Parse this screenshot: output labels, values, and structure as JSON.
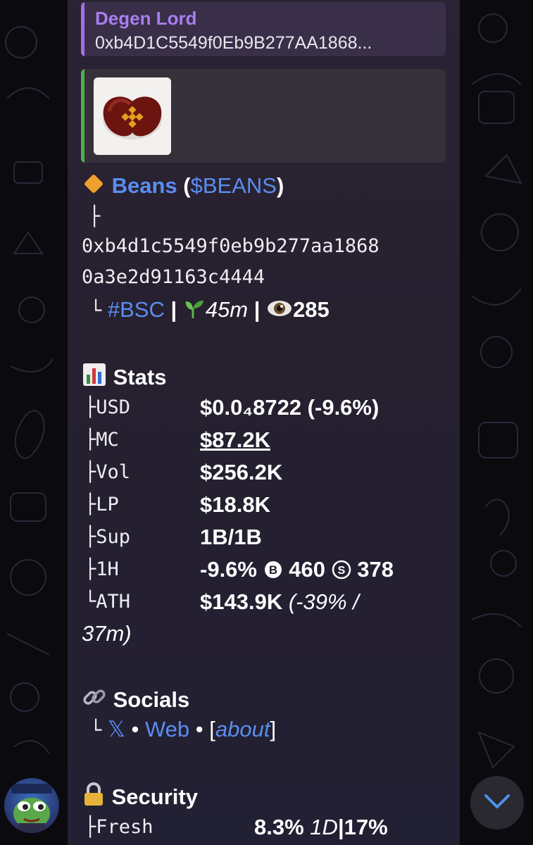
{
  "reply": {
    "sender": "Degen Lord",
    "preview": "0xb4D1C5549f0Eb9B277AA1868..."
  },
  "token": {
    "name": "Beans",
    "ticker": "$BEANS",
    "tree_mid": "├",
    "address_line1": "0xb4d1c5549f0eb9b277aa1868",
    "address_line2": "0a3e2d91163c4444",
    "tree_end": "└",
    "chain_tag": "#BSC",
    "age": "45m",
    "views": "285"
  },
  "stats": {
    "heading": "Stats",
    "rows": [
      {
        "label": "├USD",
        "value": "$0.0₄8722 (-9.6%)"
      },
      {
        "label": "├MC",
        "value": "$87.2K"
      },
      {
        "label": "├Vol",
        "value": "$256.2K"
      },
      {
        "label": "├LP",
        "value": "$18.8K"
      },
      {
        "label": "├Sup",
        "value": "1B/1B"
      },
      {
        "label": "├1H",
        "value": "-9.6%",
        "buys": "460",
        "sells": "378"
      },
      {
        "label": "└ATH",
        "value": "$143.9K",
        "value_extra": "(-39% /",
        "value_cont": "37m)"
      }
    ]
  },
  "socials": {
    "heading": "Socials",
    "tree": "└",
    "x_link": "𝕏",
    "sep": "•",
    "web_link": "Web",
    "about_open": "[",
    "about_link": "about",
    "about_close": "]"
  },
  "security": {
    "heading": "Security",
    "fresh_label": "├Fresh",
    "fresh_value": "8.3%",
    "fresh_period": "1D",
    "fresh_sep": "|",
    "fresh_value2": "17%"
  },
  "colors": {
    "link": "#5b8df0",
    "reply_accent": "#a36ee6",
    "preview_accent": "#4fae4e",
    "bubble": "#26202f"
  }
}
